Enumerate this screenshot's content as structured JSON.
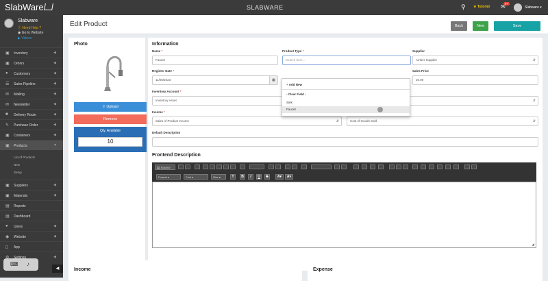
{
  "app": {
    "logo": "SlabWare",
    "title": "SLABWARE"
  },
  "topbar": {
    "tutorial": "Tutorial",
    "notification_count": "9+",
    "username": "Slabware"
  },
  "profile": {
    "name": "Slabware",
    "help": "Need Help ?",
    "website": "Go to Website",
    "videos": "Videos"
  },
  "nav": [
    {
      "label": "Inventory",
      "icon": "cubes-icon"
    },
    {
      "label": "Orders",
      "icon": "cart-icon"
    },
    {
      "label": "Customers",
      "icon": "users-icon"
    },
    {
      "label": "Sales Pipeline",
      "icon": "pipeline-icon"
    },
    {
      "label": "Mailing",
      "icon": "mail-icon"
    },
    {
      "label": "Newsletter",
      "icon": "newsletter-icon"
    },
    {
      "label": "Delivery Route",
      "icon": "truck-icon"
    },
    {
      "label": "Purchase Order",
      "icon": "purchase-icon"
    },
    {
      "label": "Containers",
      "icon": "container-icon"
    },
    {
      "label": "Products",
      "icon": "products-icon"
    }
  ],
  "products_sub": [
    "List of Products",
    "New",
    "Setup"
  ],
  "nav2": [
    {
      "label": "Suppliers",
      "icon": "supplier-icon"
    },
    {
      "label": "Materials",
      "icon": "materials-icon"
    },
    {
      "label": "Reports",
      "icon": "chart-icon"
    },
    {
      "label": "Dashboard",
      "icon": "dashboard-icon"
    },
    {
      "label": "Users",
      "icon": "user-icon"
    },
    {
      "label": "Website",
      "icon": "globe-icon"
    },
    {
      "label": "App",
      "icon": "mobile-icon"
    },
    {
      "label": "Settings",
      "icon": "gear-icon"
    }
  ],
  "page": {
    "title": "Edit Product",
    "back": "Back",
    "new": "New",
    "save": "Save"
  },
  "photo": {
    "title": "Photo",
    "upload": "Upload",
    "remove": "Remove",
    "qty_label": "Qty. Available",
    "qty_value": "10"
  },
  "info": {
    "title": "Information",
    "name_label": "Name",
    "name_value": "Faucet",
    "type_label": "Product Type",
    "type_placeholder": "Search here...",
    "supplier_label": "Supplier",
    "supplier_value": "Amber Supplier",
    "register_label": "Register Date",
    "register_value": "11/06/2023",
    "sales_price_label": "Sales Price",
    "sales_price_value": "20.00",
    "inv_account_label": "Inventory Account",
    "inv_account_value": "Inventory Asset",
    "income_label": "Income",
    "income_value": "Sales of Product Income",
    "expense_label": "Expense",
    "expense_value": "Cost of Goods Sold",
    "default_desc_label": "Default Description"
  },
  "dropdown": {
    "add_new": "Add New",
    "clear": "- Clear Field -",
    "options": [
      "Sink",
      "Faucet"
    ]
  },
  "frontend": {
    "title": "Frontend Description",
    "source": "Source",
    "format": "Format",
    "font": "Font",
    "size": "Size",
    "bold": "B",
    "italic": "I",
    "underline": "U",
    "strike": "S",
    "textcolor": "A",
    "bgcolor": "A"
  },
  "bottom": {
    "income": "Income",
    "expense": "Expense"
  },
  "colors": {
    "sidebar": "#3a3a3a",
    "upload": "#3b8fd9",
    "remove": "#f26b5b",
    "qty": "#2a6fb5",
    "new": "#3ea24a",
    "save": "#17a2a5",
    "back": "#777777"
  }
}
